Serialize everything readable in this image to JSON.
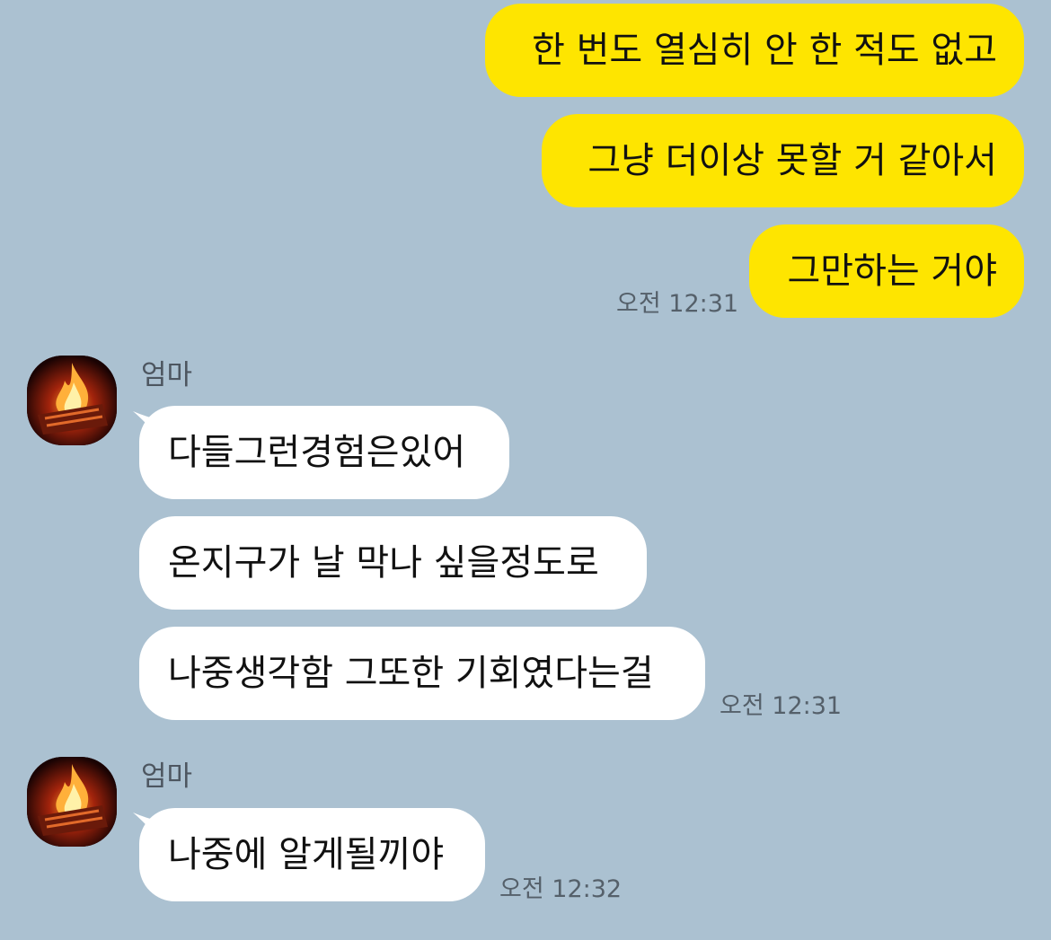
{
  "outgoing": {
    "messages": [
      "한 번도 열심히 안 한 적도 없고",
      "그냥 더이상 못할 거 같아서",
      "그만하는 거야"
    ],
    "time": "오전 12:31"
  },
  "incoming_groups": [
    {
      "sender": "엄마",
      "avatar": "fire-icon",
      "messages": [
        "다들그런경험은있어",
        "온지구가 날 막나 싶을정도로",
        "나중생각함 그또한 기회였다는걸"
      ],
      "time": "오전 12:31"
    },
    {
      "sender": "엄마",
      "avatar": "fire-icon",
      "messages": [
        "나중에 알게될끼야"
      ],
      "time": "오전 12:32"
    }
  ],
  "colors": {
    "background": "#abc1d1",
    "outgoing_bubble": "#fee500",
    "incoming_bubble": "#ffffff"
  }
}
